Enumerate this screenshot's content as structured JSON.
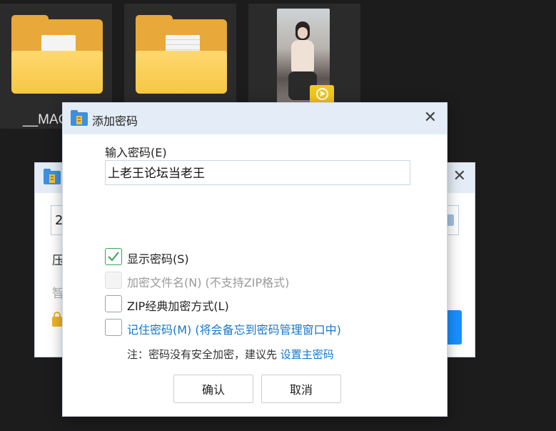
{
  "desktop": {
    "items": [
      {
        "name": "__MAC"
      },
      {
        "name": ""
      },
      {
        "name": ""
      }
    ]
  },
  "background_dialog": {
    "input_value": "2",
    "line1": "压",
    "line2": "智"
  },
  "dialog": {
    "title": "添加密码",
    "close": "✕",
    "password_label": "输入密码(E)",
    "password_value": "上老王论坛当老王",
    "options": [
      {
        "label": "显示密码(S)",
        "checked": true,
        "disabled": false
      },
      {
        "label": "加密文件名(N) (不支持ZIP格式)",
        "checked": false,
        "disabled": true
      },
      {
        "label": "ZIP经典加密方式(L)",
        "checked": false,
        "disabled": false
      },
      {
        "label": "记住密码(M) (将会备忘到密码管理窗口中)",
        "checked": false,
        "disabled": false
      }
    ],
    "note_text": "注：密码没有安全加密，建议先",
    "note_link": "设置主密码",
    "ok_label": "确认",
    "cancel_label": "取消"
  },
  "colors": {
    "accent": "#1677c9",
    "check": "#2fa85a",
    "titlebar": "#e4edf7",
    "folder": "#f6c744",
    "play_badge": "#f2c81c"
  },
  "icons": [
    "folder-icon",
    "document-icon",
    "video-thumbnail",
    "play-icon",
    "archive-app-icon",
    "close-icon",
    "check-icon",
    "lock-icon"
  ]
}
